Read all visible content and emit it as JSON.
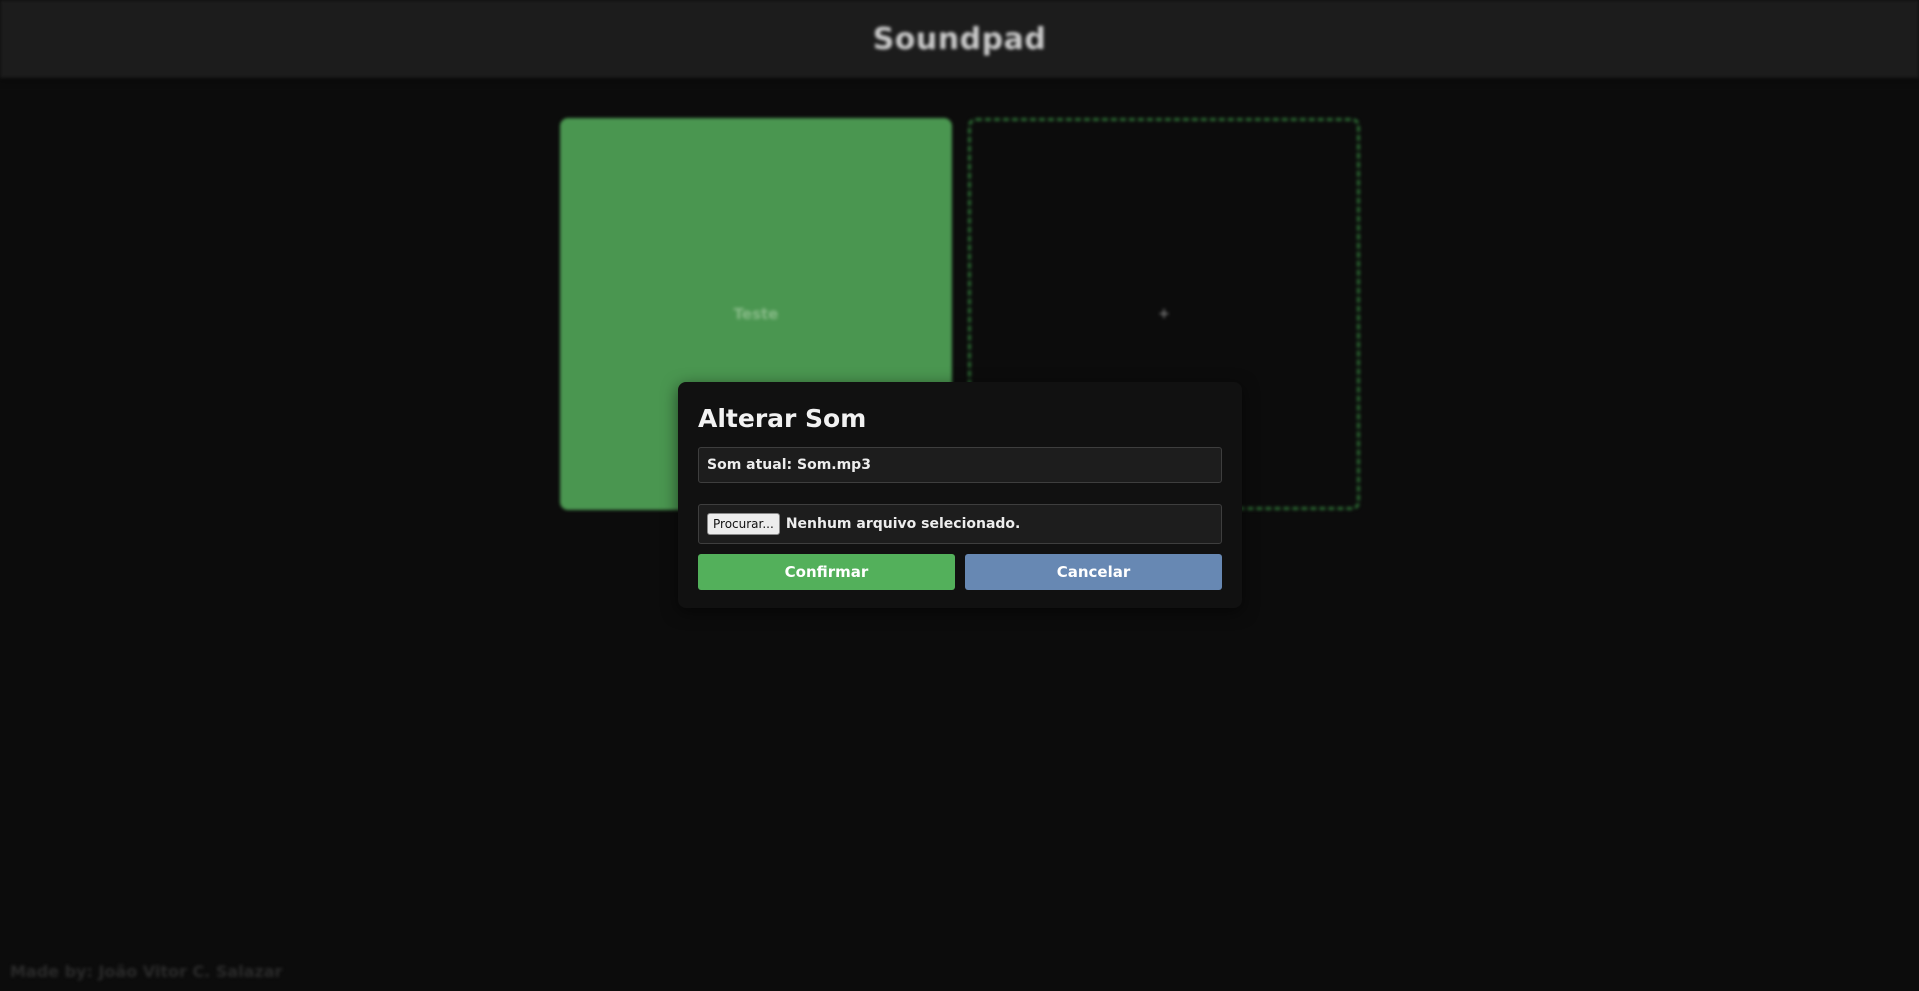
{
  "app": {
    "title": "Soundpad",
    "footer": "Made by: João Vitor C. Salazar"
  },
  "pads": [
    {
      "label": "Teste",
      "color": "#4a9650"
    },
    {
      "label": "+",
      "border_color": "#2c6a33"
    }
  ],
  "modal": {
    "title": "Alterar Som",
    "current_sound": "Som atual: Som.mp3",
    "browse_label": "Procurar...",
    "file_status": "Nenhum arquivo selecionado.",
    "confirm_label": "Confirmar",
    "cancel_label": "Cancelar",
    "confirm_color": "#53b05b",
    "cancel_color": "#6788b3"
  }
}
